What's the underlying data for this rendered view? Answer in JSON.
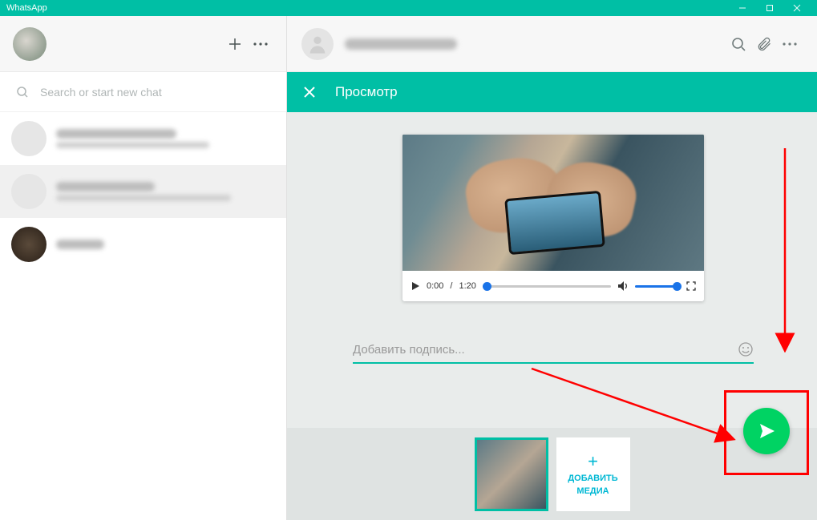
{
  "window": {
    "app_name": "WhatsApp"
  },
  "sidebar": {
    "search_placeholder": "Search or start new chat"
  },
  "preview": {
    "title": "Просмотр",
    "video": {
      "current_time": "0:00",
      "duration": "1:20"
    },
    "caption_placeholder": "Добавить подпись...",
    "add_media_line1": "ДОБАВИТЬ",
    "add_media_line2": "МЕДИА"
  },
  "colors": {
    "brand": "#00bfa5",
    "send": "#00d363",
    "accent_blue": "#1a73e8"
  }
}
